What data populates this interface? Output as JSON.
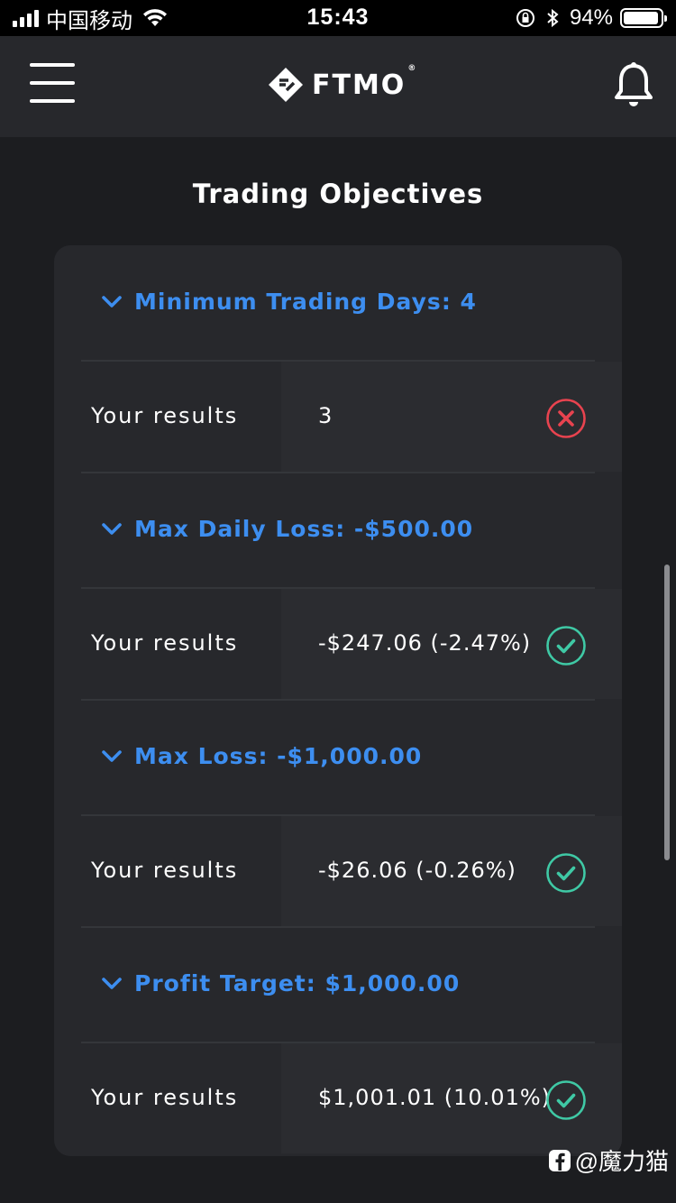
{
  "status_bar": {
    "carrier": "中国移动",
    "time": "15:43",
    "battery": "94%",
    "battery_level": 0.94,
    "icons": [
      "signal-icon",
      "wifi-icon",
      "rotation-lock-icon",
      "bluetooth-icon",
      "battery-icon"
    ]
  },
  "header": {
    "logo_text": "FTMO",
    "logo_reg": "®",
    "icons": [
      "menu-icon",
      "bell-icon"
    ]
  },
  "page": {
    "title": "Trading Objectives"
  },
  "objectives": [
    {
      "title": "Minimum Trading Days: 4",
      "label": "Your results",
      "value": "3",
      "status": "failed"
    },
    {
      "title": "Max Daily Loss: -$500.00",
      "label": "Your results",
      "value": "-$247.06 (-2.47%)",
      "status": "passed"
    },
    {
      "title": "Max Loss: -$1,000.00",
      "label": "Your results",
      "value": "-$26.06 (-0.26%)",
      "status": "passed"
    },
    {
      "title": "Profit Target: $1,000.00",
      "label": "Your results",
      "value": "$1,001.01 (10.01%)",
      "status": "passed"
    }
  ],
  "colors": {
    "accent": "#3d8ef0",
    "pass": "#3fc9a5",
    "fail": "#e8434f",
    "background": "#1c1d20",
    "card": "#27282c"
  },
  "watermark": {
    "text": "@魔力猫"
  }
}
